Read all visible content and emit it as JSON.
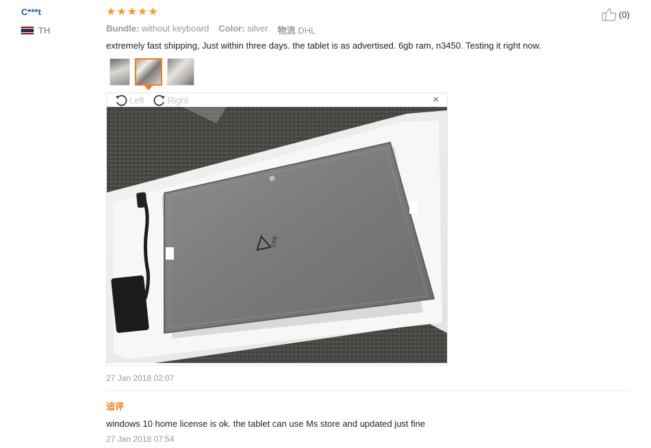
{
  "author": "C***t",
  "country": "TH",
  "rating_stars": 5,
  "helpful_count": "(0)",
  "attributes": [
    {
      "label": "Bundle:",
      "value": "without keyboard"
    },
    {
      "label": "Color:",
      "value": "silver"
    },
    {
      "label": "物流",
      "value": "DHL"
    }
  ],
  "review_text": "extremely fast shipping, Just within three days. the tablet is as advertised. 6gb ram, n3450. Testing it right now.",
  "viewer": {
    "rotate_left": "Left",
    "rotate_right": "Right",
    "close": "×"
  },
  "photo_mark": "CPE",
  "review_date": "27 Jan 2018 02:07",
  "additional": {
    "label": "追评",
    "text": "windows 10 home license is ok. the tablet can use Ms store and updated just fine",
    "date": "27 Jan 2018 07:54"
  },
  "colors": {
    "star": "#f59b1e",
    "accent": "#f57b1e",
    "author": "#1a5a9e"
  }
}
